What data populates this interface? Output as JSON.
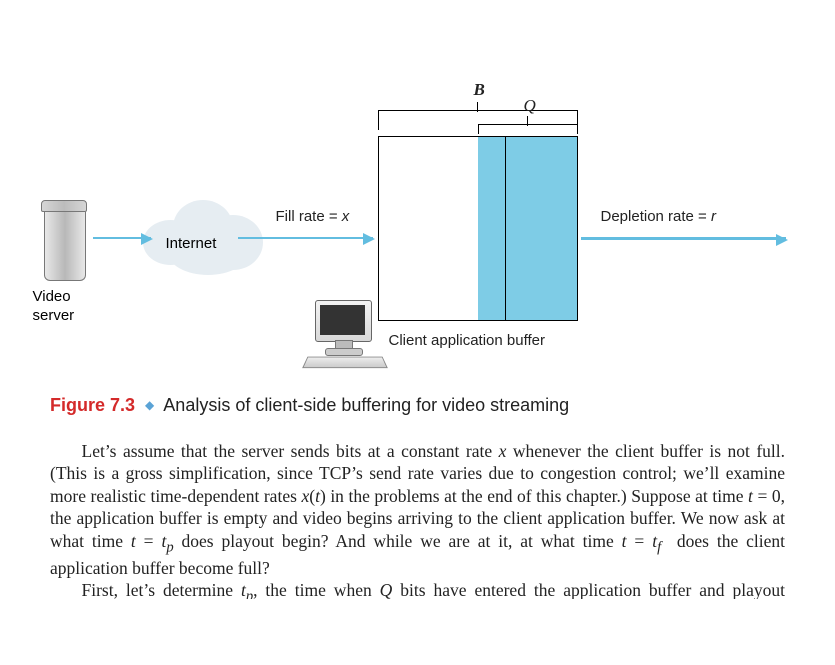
{
  "diagram": {
    "B_label": "B",
    "Q_label": "Q",
    "fill_rate_text": "Fill rate = ",
    "fill_rate_var": "x",
    "depletion_rate_text": "Depletion rate = ",
    "depletion_rate_var": "r",
    "server_label_l1": "Video",
    "server_label_l2": "server",
    "internet_label": "Internet",
    "client_buffer_label": "Client application buffer"
  },
  "caption": {
    "number": "Figure 7.3",
    "title": "Analysis of client-side buffering for video streaming"
  },
  "para1": {
    "t1": "Let’s assume that the server sends bits at a constant rate ",
    "v1": "x",
    "t2": " whenever the client buffer is not full. (This is a gross simplification, since TCP’s send rate varies due to congestion control; we’ll examine more realistic time-dependent rates ",
    "v2": "x",
    "t3": "(",
    "v3": "t",
    "t4": ") in the problems at the end of this chapter.) Suppose at time ",
    "v4": "t",
    "t5": " = 0, the application buffer is empty and video begins arriving to the client application buffer. We now ask at what time ",
    "v5": "t",
    "t6": " = ",
    "v6": "t",
    "s6": "p",
    "t7": " does playout begin? And while we are at it, at what time ",
    "v7": "t",
    "t8": " = ",
    "v8": "t",
    "s8": "f",
    "t9": " does the client application buffer become full?"
  },
  "para2": {
    "t1": "First, let’s determine ",
    "v1": "t",
    "s1": "p",
    "t2": ", the time when ",
    "v2": "Q",
    "t3": " bits have entered the application buffer and playout begins. Recall that bits arrive to the client application buffer at"
  }
}
